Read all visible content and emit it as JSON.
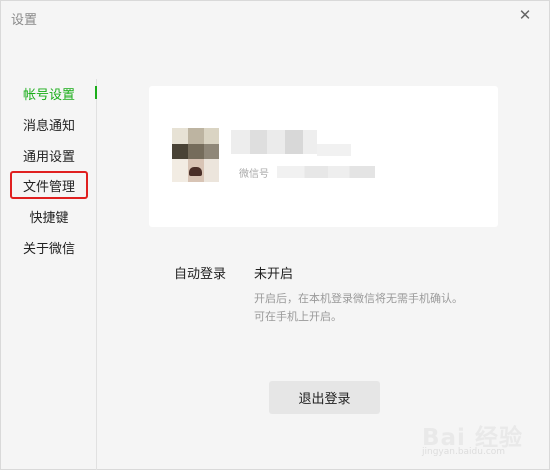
{
  "window": {
    "title": "设置",
    "close_icon": "✕"
  },
  "sidebar": {
    "items": [
      {
        "label": "帐号设置",
        "active": true
      },
      {
        "label": "消息通知"
      },
      {
        "label": "通用设置"
      },
      {
        "label": "文件管理",
        "highlighted": true
      },
      {
        "label": "快捷键"
      },
      {
        "label": "关于微信"
      }
    ]
  },
  "account": {
    "wechat_id_prefix": "微信号"
  },
  "auto_login": {
    "label": "自动登录",
    "value": "未开启",
    "description_line1": "开启后，在本机登录微信将无需手机确认。",
    "description_line2": "可在手机上开启。"
  },
  "logout_label": "退出登录",
  "watermark": {
    "text": "Bai 经验",
    "url": "jingyan.baidu.com"
  },
  "colors": {
    "accent": "#1aad19",
    "highlight_box": "#e02020"
  }
}
